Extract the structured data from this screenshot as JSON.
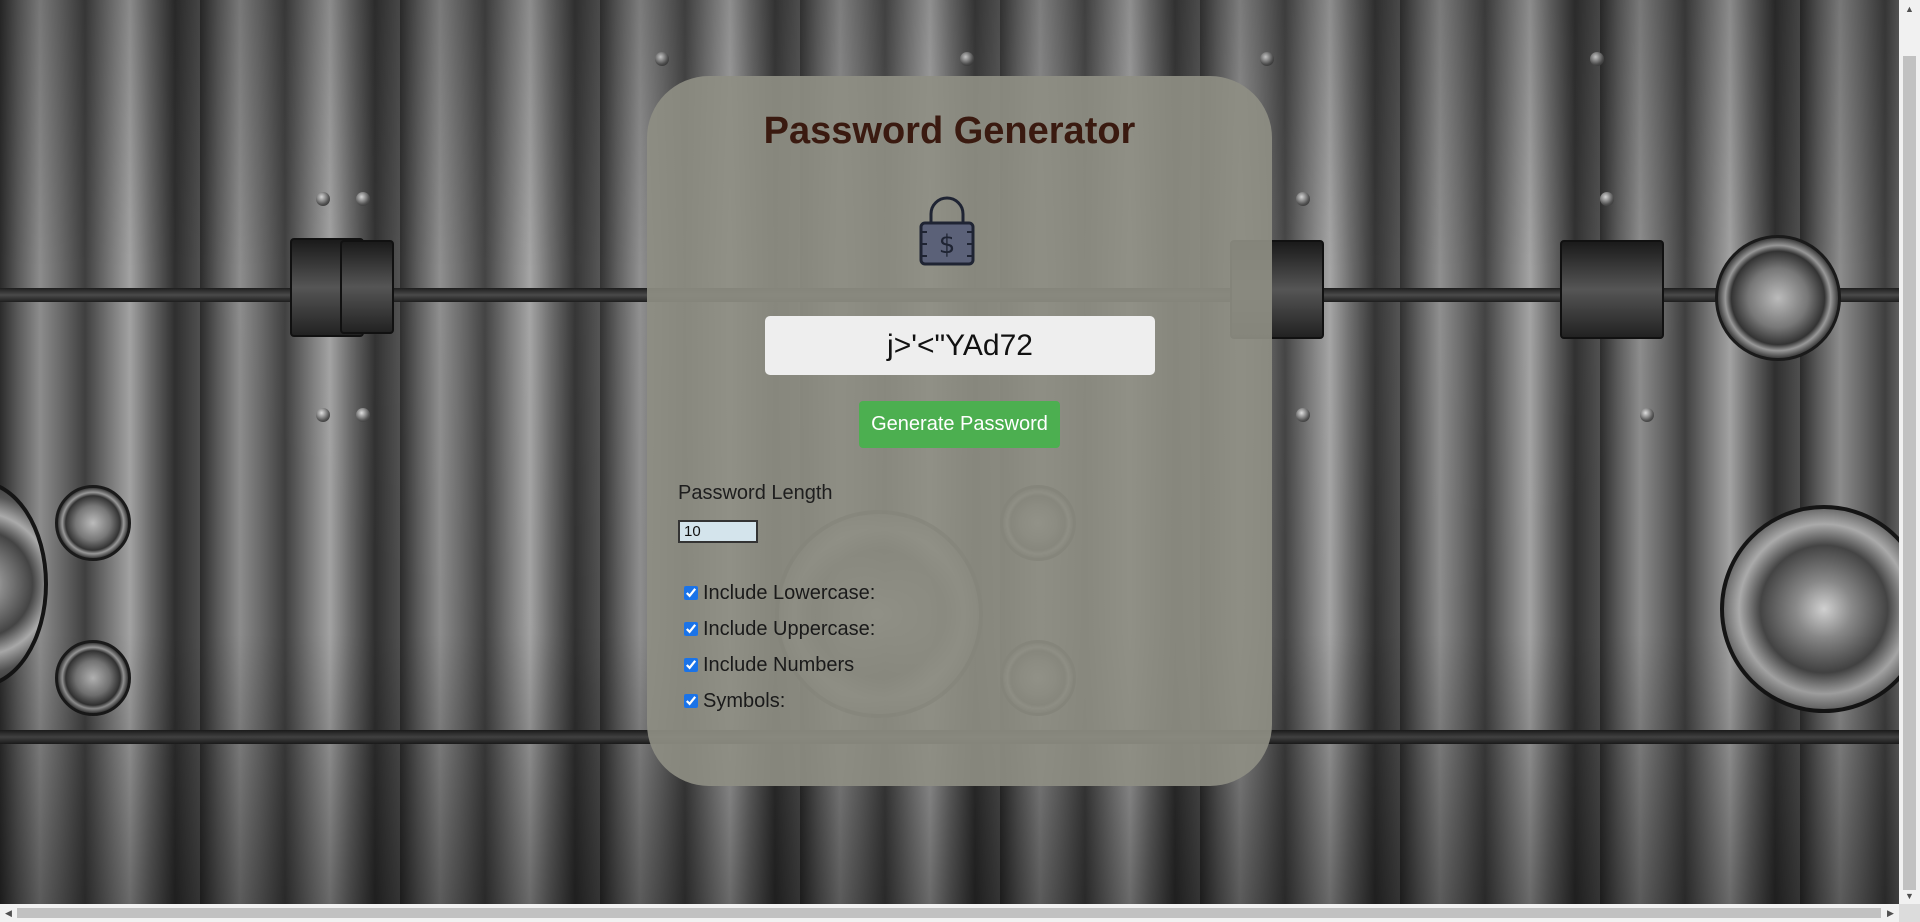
{
  "app": {
    "title": "Password Generator"
  },
  "icons": {
    "lock": "padlock-dollar-icon",
    "scroll_up": "chevron-up-icon",
    "scroll_down": "chevron-down-icon",
    "scroll_left": "chevron-left-icon",
    "scroll_right": "chevron-right-icon"
  },
  "generator": {
    "password": "j>'<\"YAd72",
    "generate_label": "Generate Password",
    "length_label": "Password Length",
    "length_value": "10"
  },
  "options": [
    {
      "label": "Include Lowercase:",
      "checked": true
    },
    {
      "label": "Include Uppercase:",
      "checked": true
    },
    {
      "label": "Include Numbers",
      "checked": true
    },
    {
      "label": "Symbols:",
      "checked": true
    }
  ],
  "colors": {
    "title": "#3a1a10",
    "button": "#4caf50",
    "card": "#8e8e83",
    "length_input_bg": "#d4e4ec"
  }
}
